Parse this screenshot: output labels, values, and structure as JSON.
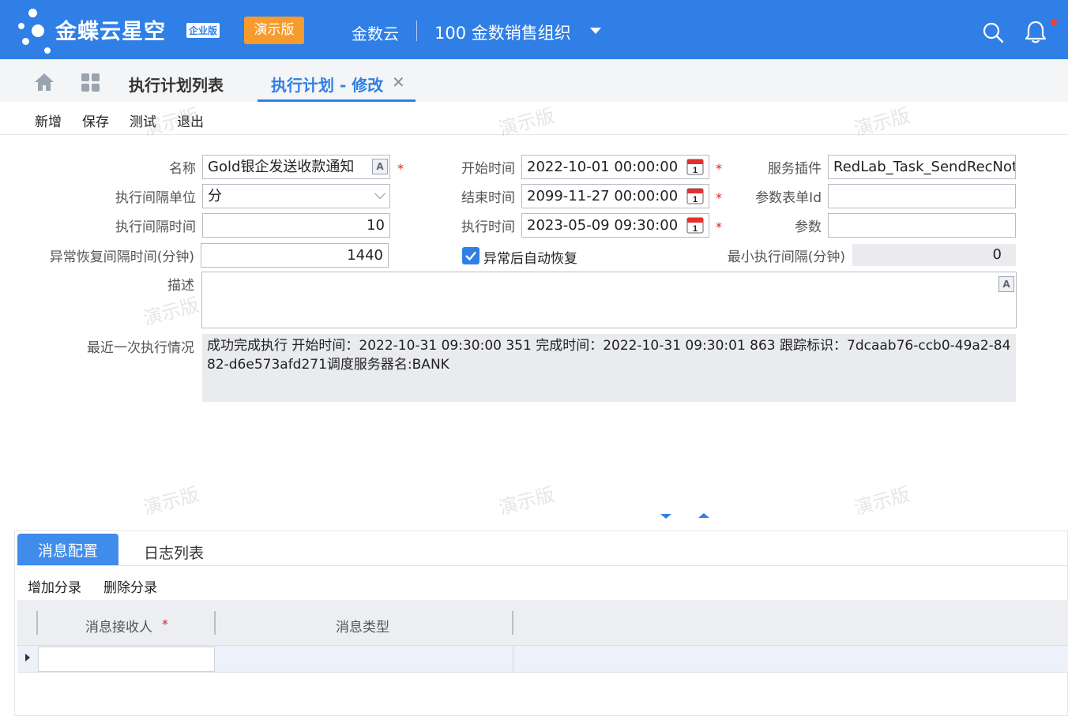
{
  "header": {
    "brand": "金蝶云星空",
    "edition": "企业版",
    "demo_badge": "演示版",
    "org_name": "金数云",
    "org_unit": "100  金数销售组织",
    "colors": {
      "primary": "#2f7fe6",
      "badge": "#f79b2e",
      "required": "#e02020"
    }
  },
  "tabs": [
    {
      "label": "执行计划列表"
    },
    {
      "label": "执行计划 - 修改",
      "close": "✕"
    }
  ],
  "toolbar": [
    "新增",
    "保存",
    "测试",
    "退出"
  ],
  "form": {
    "name_label": "名称",
    "name_value": "Gold银企发送收款通知",
    "interval_unit_label": "执行间隔单位",
    "interval_unit_value": "分",
    "interval_time_label": "执行间隔时间",
    "interval_time_value": "10",
    "recover_interval_label": "异常恢复间隔时间(分钟)",
    "recover_interval_value": "1440",
    "start_label": "开始时间",
    "start_value": "2022-10-01 00:00:00",
    "end_label": "结束时间",
    "end_value": "2099-11-27 00:00:00",
    "exec_label": "执行时间",
    "exec_value": "2023-05-09 09:30:00",
    "auto_recover_label": "异常后自动恢复",
    "auto_recover_checked": true,
    "plugin_label": "服务插件",
    "plugin_value": "RedLab_Task_SendRecNoti",
    "param_form_label": "参数表单Id",
    "param_form_value": "",
    "param_label": "参数",
    "param_value": "",
    "min_interval_label": "最小执行间隔(分钟)",
    "min_interval_value": "0",
    "desc_label": "描述",
    "desc_value": "",
    "last_exec_label": "最近一次执行情况",
    "last_exec_value": "成功完成执行  开始时间：2022-10-31 09:30:00 351  完成时间：2022-10-31 09:30:01 863  跟踪标识：7dcaab76-ccb0-49a2-8482-d6e573afd271调度服务器名:BANK",
    "required_mark": "*",
    "text_icon": "A"
  },
  "subtabs": [
    "消息配置",
    "日志列表"
  ],
  "subtoolbar": [
    "增加分录",
    "删除分录"
  ],
  "grid": {
    "columns": [
      "消息接收人",
      "消息类型"
    ],
    "rows": [
      [
        "",
        ""
      ]
    ]
  },
  "watermark": "演示版",
  "icons": [
    "home-icon",
    "grid-icon",
    "search-icon",
    "bell-icon",
    "calendar-icon",
    "text-edit-icon",
    "chevron-down-icon",
    "check-icon"
  ]
}
